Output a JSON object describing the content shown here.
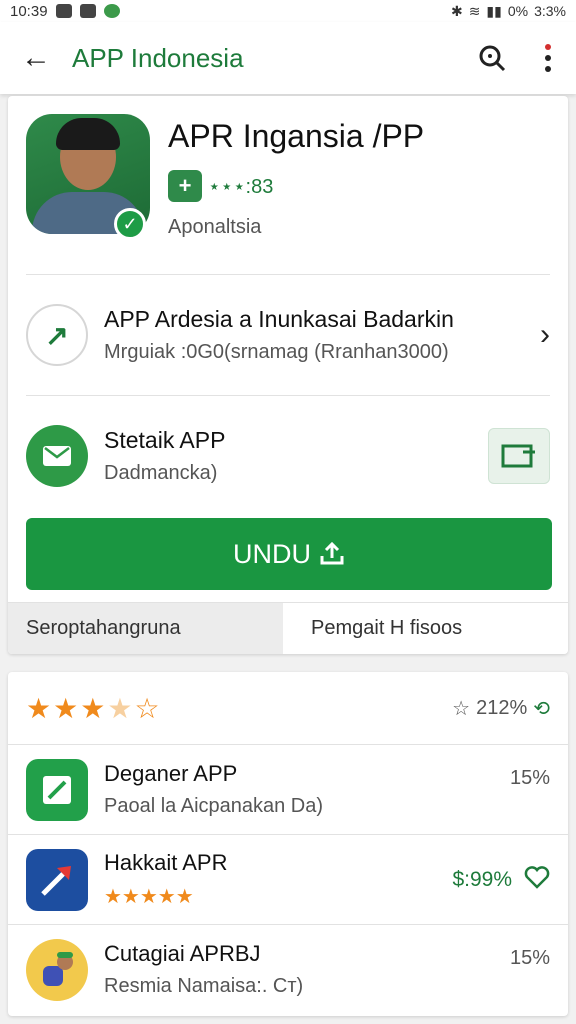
{
  "status": {
    "time": "10:39",
    "battery": "0%",
    "net": "3:3%"
  },
  "appbar": {
    "title": "APP Indonesia"
  },
  "app": {
    "title": "APR Ingansia /PP",
    "meta": "⋆⋆⋆:83",
    "developer": "Aponaltsia"
  },
  "row1": {
    "title": "APP Ardesia a Inunkasai Badarkin",
    "subtitle": "Mrguiak :0G0(srnamag (Rranhan3000)"
  },
  "row2": {
    "title": "Stetaik APP",
    "subtitle": "Dadmancka)"
  },
  "download": {
    "label": "UNDU"
  },
  "tabs": [
    "Seroptahangruna",
    "Pemgait H fisoos"
  ],
  "rating": {
    "stars": 3,
    "score": "212%"
  },
  "items": [
    {
      "title": "Deganer APP",
      "subtitle": "Paoal la Aicpanakan Da)",
      "right": "15%"
    },
    {
      "title": "Hakkait APR",
      "subtitle": "★★★★★",
      "price": "$:99%"
    },
    {
      "title": "Cutagiai APRBJ",
      "subtitle": "Resmia Namaisa:. Ст)",
      "right": "15%"
    }
  ],
  "colors": {
    "accent": "#1a9641",
    "star": "#f08a1c"
  }
}
